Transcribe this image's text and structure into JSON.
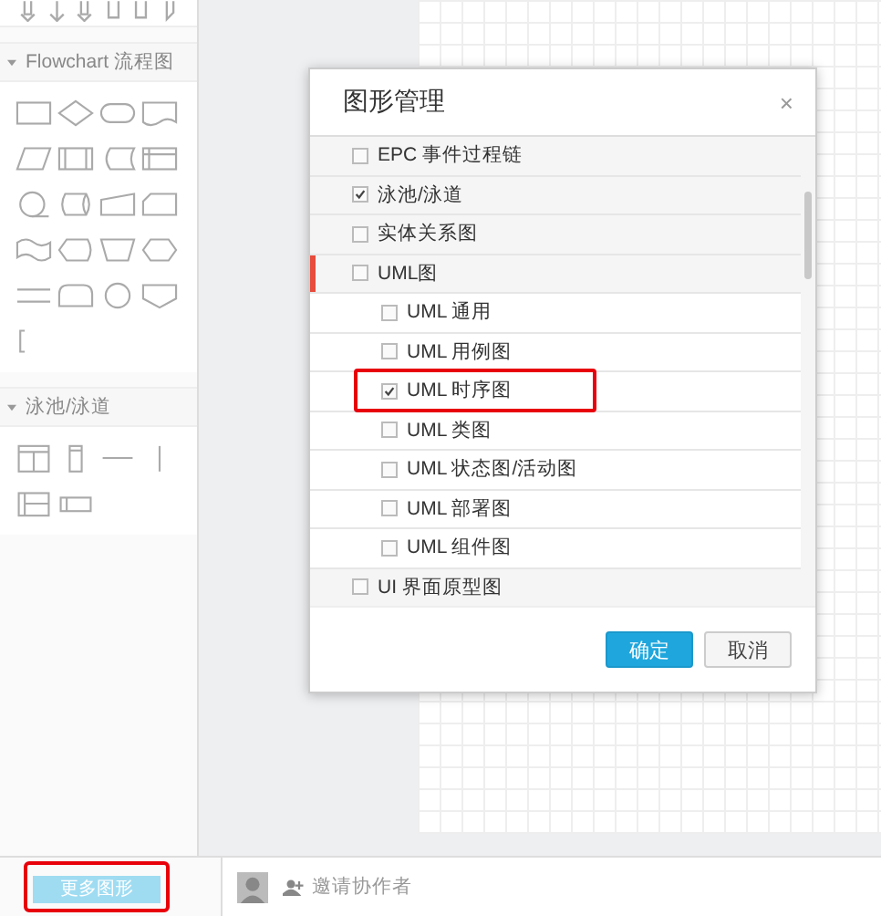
{
  "sidebar": {
    "sections": [
      {
        "title": "Flowchart 流程图",
        "expanded": true
      },
      {
        "title": "泳池/泳道",
        "expanded": true
      }
    ],
    "more_button": {
      "label": "更多图形",
      "highlighted": true
    }
  },
  "collaborate": {
    "label": "邀请协作者"
  },
  "dialog": {
    "title": "图形管理",
    "close": "×",
    "items": [
      {
        "label": "EPC 事件过程链",
        "checked": false,
        "selected": false
      },
      {
        "label": "泳池/泳道",
        "checked": true,
        "selected": false
      },
      {
        "label": "实体关系图",
        "checked": false,
        "selected": false
      },
      {
        "label": "UML图",
        "checked": false,
        "selected": true,
        "children": [
          {
            "label": "UML 通用",
            "checked": false,
            "highlighted": false
          },
          {
            "label": "UML 用例图",
            "checked": false,
            "highlighted": false
          },
          {
            "label": "UML 时序图",
            "checked": true,
            "highlighted": true
          },
          {
            "label": "UML 类图",
            "checked": false,
            "highlighted": false
          },
          {
            "label": "UML 状态图/活动图",
            "checked": false,
            "highlighted": false
          },
          {
            "label": "UML 部署图",
            "checked": false,
            "highlighted": false
          },
          {
            "label": "UML 组件图",
            "checked": false,
            "highlighted": false
          }
        ]
      },
      {
        "label": "UI 界面原型图",
        "checked": false,
        "selected": false
      }
    ],
    "buttons": [
      {
        "label": "确定",
        "kind": "primary"
      },
      {
        "label": "取消",
        "kind": "secondary"
      }
    ]
  }
}
